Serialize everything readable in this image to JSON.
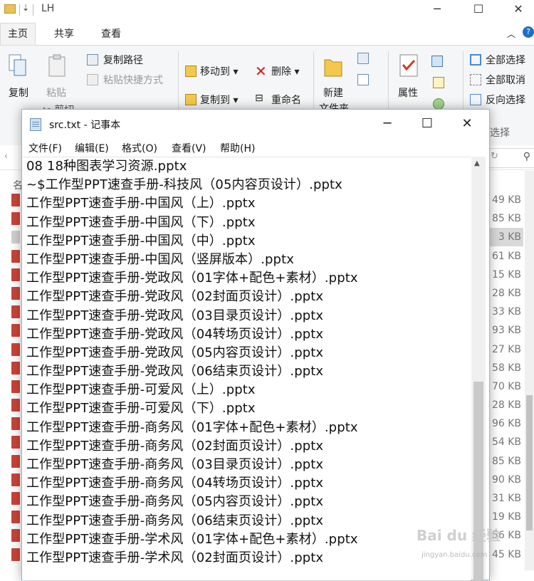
{
  "explorer": {
    "title": "LH",
    "quick_arrow": "⇣",
    "tabs": [
      "主页",
      "共享",
      "查看"
    ],
    "ribbon": {
      "copy": "复制",
      "paste": "粘贴",
      "copy_path": "复制路径",
      "paste_shortcut": "粘贴快捷方式",
      "cut": "剪切",
      "move_to": "移动到",
      "copy_to": "复制到",
      "delete": "删除",
      "rename": "重命名",
      "new": "新建",
      "new_folder": "文件夹",
      "properties": "属性",
      "select_all": "全部选择",
      "select_none": "全部取消",
      "invert_selection": "反向选择",
      "select_group": "选择"
    },
    "col_header": "名",
    "sizes": [
      "49 KB",
      "85 KB",
      "3 KB",
      "61 KB",
      "15 KB",
      "28 KB",
      "33 KB",
      "93 KB",
      "27 KB",
      "58 KB",
      "70 KB",
      "28 KB",
      "96 KB",
      "54 KB",
      "85 KB",
      "90 KB",
      "31 KB",
      "19 KB",
      "56 KB",
      "45 KB"
    ]
  },
  "notepad": {
    "title": "src.txt - 记事本",
    "menu": [
      "文件(F)",
      "编辑(E)",
      "格式(O)",
      "查看(V)",
      "帮助(H)"
    ],
    "lines": [
      "08 18种图表学习资源.pptx",
      "~$工作型PPT速查手册-科技风（05内容页设计）.pptx",
      "工作型PPT速查手册-中国风（上）.pptx",
      "工作型PPT速查手册-中国风（下）.pptx",
      "工作型PPT速查手册-中国风（中）.pptx",
      "工作型PPT速查手册-中国风（竖屏版本）.pptx",
      "工作型PPT速查手册-党政风（01字体+配色+素材）.pptx",
      "工作型PPT速查手册-党政风（02封面页设计）.pptx",
      "工作型PPT速查手册-党政风（03目录页设计）.pptx",
      "工作型PPT速查手册-党政风（04转场页设计）.pptx",
      "工作型PPT速查手册-党政风（05内容页设计）.pptx",
      "工作型PPT速查手册-党政风（06结束页设计）.pptx",
      "工作型PPT速查手册-可爱风（上）.pptx",
      "工作型PPT速查手册-可爱风（下）.pptx",
      "工作型PPT速查手册-商务风（01字体+配色+素材）.pptx",
      "工作型PPT速查手册-商务风（02封面页设计）.pptx",
      "工作型PPT速查手册-商务风（03目录页设计）.pptx",
      "工作型PPT速查手册-商务风（04转场页设计）.pptx",
      "工作型PPT速查手册-商务风（05内容页设计）.pptx",
      "工作型PPT速查手册-商务风（06结束页设计）.pptx",
      "工作型PPT速查手册-学术风（01字体+配色+素材）.pptx",
      "工作型PPT速查手册-学术风（02封面页设计）.pptx"
    ]
  }
}
